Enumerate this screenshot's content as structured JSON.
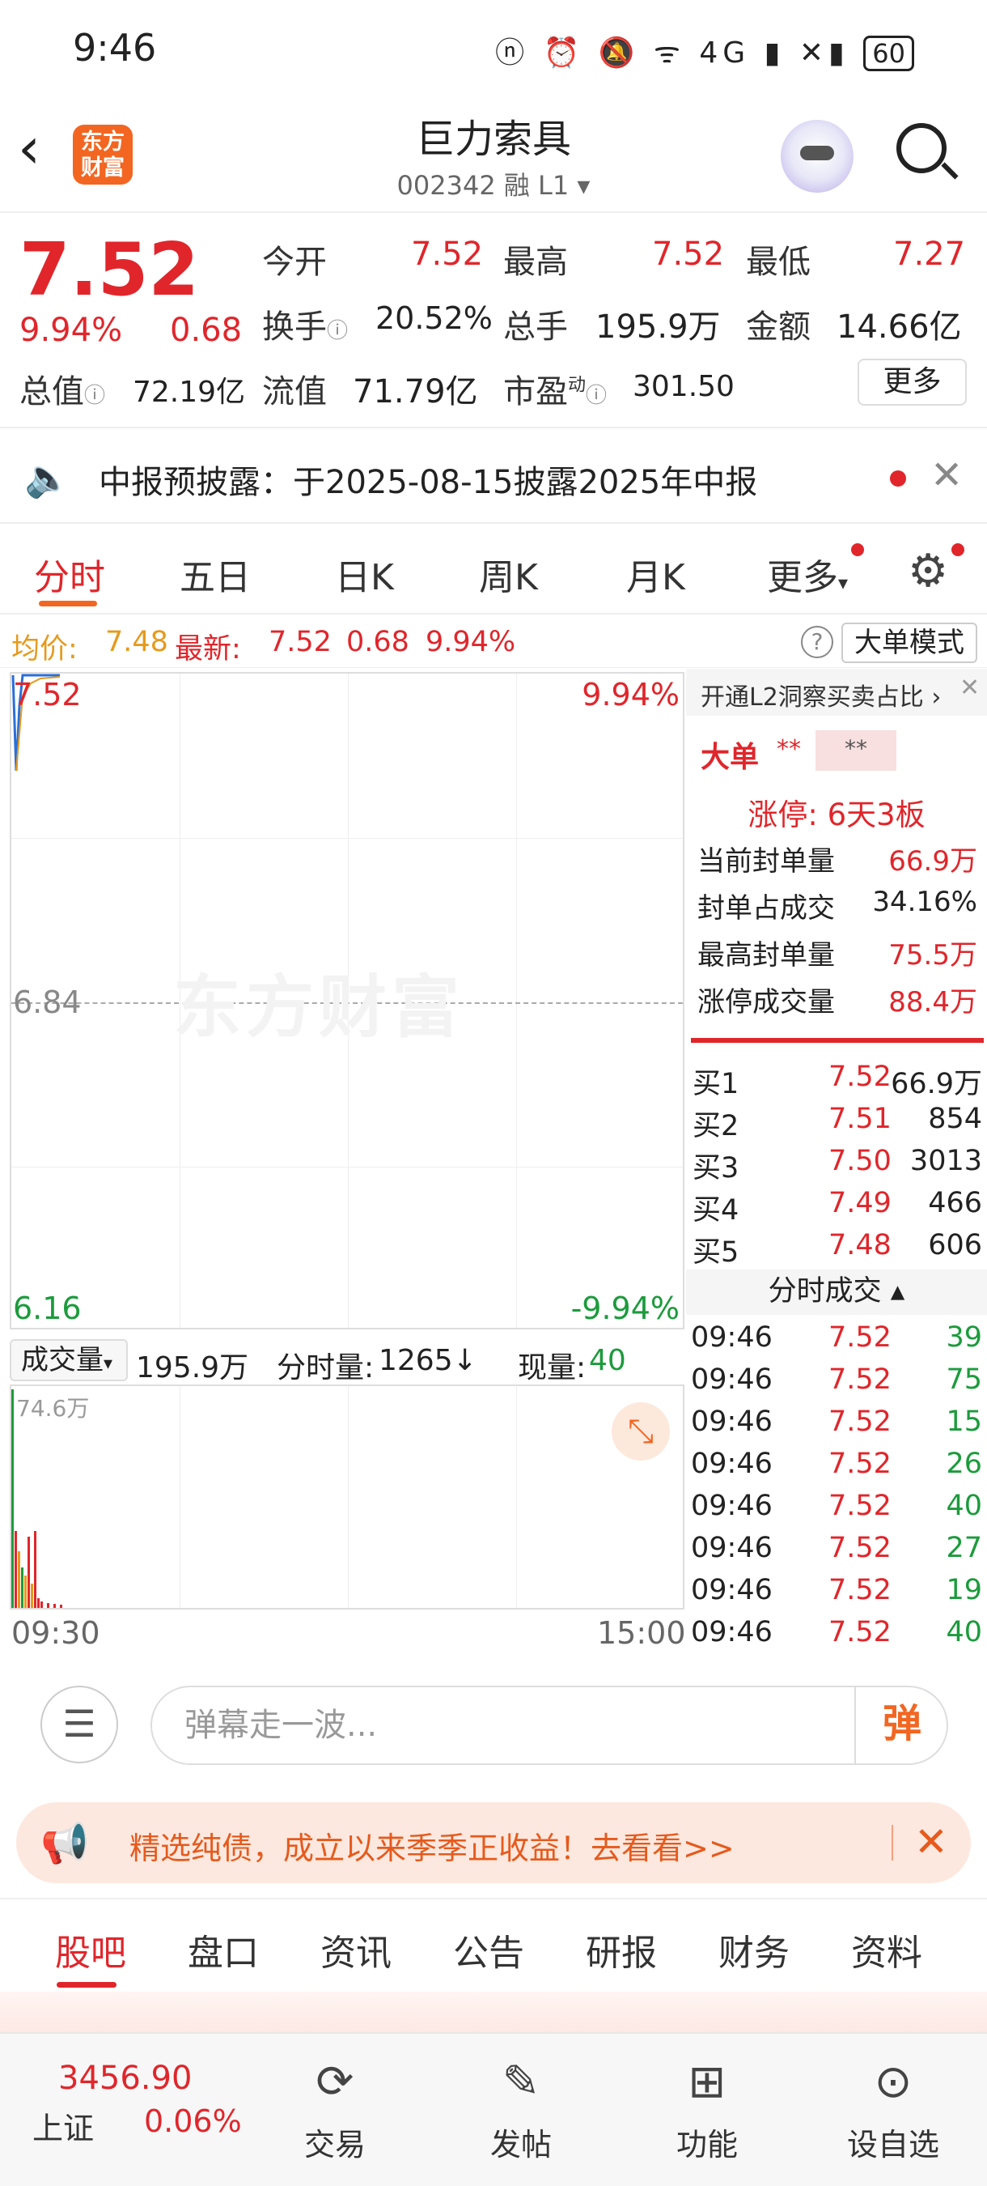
{
  "status_bar": {
    "time": "9:46",
    "icons": "ⓝ ⏰ 🔕 ᯤ 4G ▮ ✕▮",
    "battery": "60"
  },
  "header": {
    "stock_name": "巨力索具",
    "stock_code": "002342 融 L1 ▾",
    "logo_text": "东方财富"
  },
  "quote": {
    "price": "7.52",
    "change_pct": "9.94%",
    "change": "0.68",
    "open_label": "今开",
    "open": "7.52",
    "high_label": "最高",
    "high": "7.52",
    "low_label": "最低",
    "low": "7.27",
    "turnover_label": "换手",
    "turnover": "20.52%",
    "volume_label": "总手",
    "volume": "195.9万",
    "amount_label": "金额",
    "amount": "14.66亿",
    "mcap_label": "总值",
    "mcap": "72.19亿",
    "float_label": "流值",
    "float_val": "71.79亿",
    "pe_label": "市盈",
    "pe_sup": "动",
    "pe": "301.50",
    "more_label": "更多"
  },
  "notice": {
    "text": "中报预披露：于2025-08-15披露2025年中报"
  },
  "tabs": [
    "分时",
    "五日",
    "日K",
    "周K",
    "月K",
    "更多"
  ],
  "avg_bar": {
    "avg_label": "均价:",
    "avg": "7.48",
    "latest_label": "最新:",
    "latest": "7.52",
    "chg": "0.68",
    "pct": "9.94%",
    "mode_label": "大单模式"
  },
  "chart": {
    "top_price": "7.52",
    "mid_price": "6.84",
    "bottom_price": "6.16",
    "top_pct": "9.94%",
    "bottom_pct": "-9.94%",
    "watermark": "东方财富"
  },
  "volume": {
    "select_label": "成交量",
    "total": "195.9万",
    "min_label": "分时量:",
    "min_val": "1265↓",
    "now_label": "现量:",
    "now_val": "40",
    "max_label": "74.6万",
    "time_start": "09:30",
    "time_end": "15:00"
  },
  "side": {
    "l2_text": "开通L2洞察买卖占比 ›",
    "big_label": "大单",
    "stars1": "**",
    "stars2": "**",
    "limit": "涨停:  6天3板",
    "stats": [
      {
        "k": "当前封单量",
        "v": "66.9万",
        "red": true
      },
      {
        "k": "封单占成交",
        "v": "34.16%",
        "red": false
      },
      {
        "k": "最高封单量",
        "v": "75.5万",
        "red": true
      },
      {
        "k": "涨停成交量",
        "v": "88.4万",
        "red": true
      }
    ],
    "orderbook": [
      {
        "k": "买1",
        "p": "7.52",
        "v": "66.9万"
      },
      {
        "k": "买2",
        "p": "7.51",
        "v": "854"
      },
      {
        "k": "买3",
        "p": "7.50",
        "v": "3013"
      },
      {
        "k": "买4",
        "p": "7.49",
        "v": "466"
      },
      {
        "k": "买5",
        "p": "7.48",
        "v": "606"
      }
    ],
    "ticks_title": "分时成交 ▴",
    "ticks": [
      {
        "t": "09:46",
        "p": "7.52",
        "v": "39"
      },
      {
        "t": "09:46",
        "p": "7.52",
        "v": "75"
      },
      {
        "t": "09:46",
        "p": "7.52",
        "v": "15"
      },
      {
        "t": "09:46",
        "p": "7.52",
        "v": "26"
      },
      {
        "t": "09:46",
        "p": "7.52",
        "v": "40"
      },
      {
        "t": "09:46",
        "p": "7.52",
        "v": "27"
      },
      {
        "t": "09:46",
        "p": "7.52",
        "v": "19"
      },
      {
        "t": "09:46",
        "p": "7.52",
        "v": "40"
      }
    ]
  },
  "danmu": {
    "placeholder": "弹幕走一波...",
    "send_label": "弹"
  },
  "ad": {
    "text": "精选纯债，成立以来季季正收益！去看看>>"
  },
  "bottom_tabs": [
    "股吧",
    "盘口",
    "资讯",
    "公告",
    "研报",
    "财务",
    "资料"
  ],
  "index": {
    "value": "3456.90",
    "name": "上证",
    "pct": "0.06%"
  },
  "bottom_nav": [
    {
      "icon": "trade-icon",
      "label": "交易"
    },
    {
      "icon": "post-icon",
      "label": "发帖"
    },
    {
      "icon": "function-icon",
      "label": "功能"
    },
    {
      "icon": "watchlist-icon",
      "label": "设自选"
    }
  ]
}
